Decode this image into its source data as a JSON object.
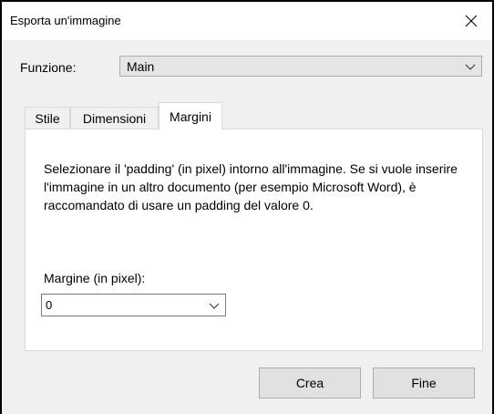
{
  "window": {
    "title": "Esporta un'immagine",
    "close_icon": "close-icon"
  },
  "function_row": {
    "label": "Funzione:",
    "selected": "Main"
  },
  "tabs": [
    {
      "label": "Stile",
      "active": false
    },
    {
      "label": "Dimensioni",
      "active": false
    },
    {
      "label": "Margini",
      "active": true
    }
  ],
  "panel": {
    "description": "Selezionare il 'padding' (in pixel) intorno all'immagine. Se si vuole inserire l'immagine in un altro documento (per esempio Microsoft Word), è raccomandato di usare un padding del valore 0.",
    "margin_label": "Margine (in pixel):",
    "margin_value": "0"
  },
  "buttons": {
    "create": "Crea",
    "finish": "Fine"
  }
}
